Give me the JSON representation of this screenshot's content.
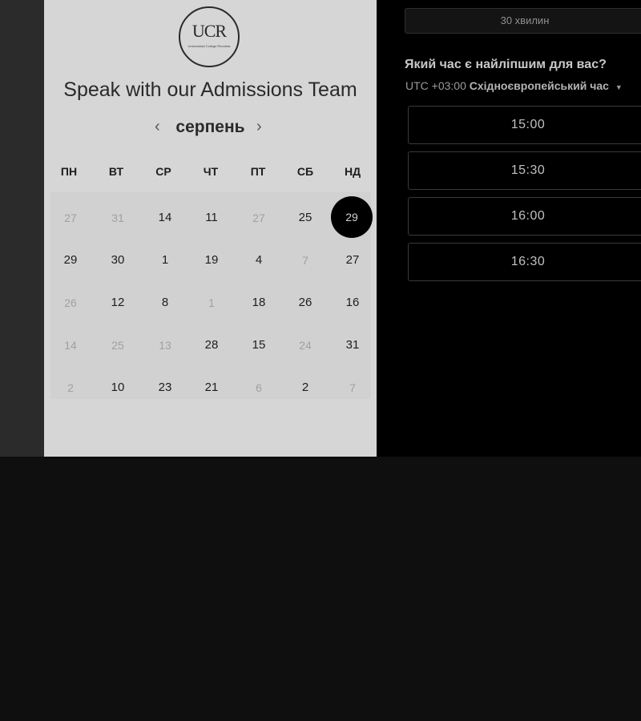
{
  "card": {
    "logo_text": "UCR",
    "logo_subtext": "Universidad College Recoleta",
    "title": "Speak with our Admissions Team"
  },
  "calendar": {
    "month": "серпень",
    "prev_icon": "chevron-left-icon",
    "next_icon": "chevron-right-icon",
    "weekdays": [
      "ПН",
      "ВТ",
      "СР",
      "ЧТ",
      "ПТ",
      "СБ",
      "НД"
    ],
    "weeks": [
      [
        "27",
        "31",
        "14",
        "11",
        "27",
        "25",
        "29"
      ],
      [
        "29",
        "30",
        "1",
        "19",
        "4",
        "7",
        "27"
      ],
      [
        "26",
        "12",
        "8",
        "1",
        "18",
        "26",
        "16"
      ],
      [
        "14",
        "25",
        "13",
        "28",
        "15",
        "24",
        "31"
      ],
      [
        "2",
        "10",
        "23",
        "21",
        "6",
        "2",
        "7"
      ]
    ],
    "selected_day": "29"
  },
  "booking": {
    "duration": "30 хвилин",
    "question": "Який час є найліпшим для вас?",
    "timezone_prefix": "UTC +03:00",
    "timezone_name": "Східноєвропейський час",
    "timezone_icon": "caret-down-icon",
    "slots": [
      "15:00",
      "15:30",
      "16:00",
      "16:30"
    ]
  },
  "colors": {
    "card_bg": "#d6d6d6",
    "panel_bg": "#000000",
    "selected_day_bg": "#000000"
  }
}
